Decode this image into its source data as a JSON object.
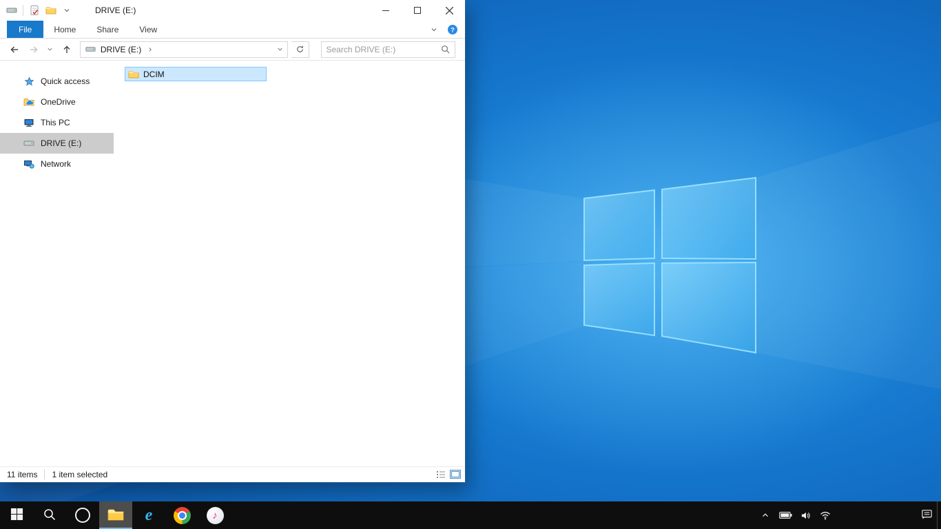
{
  "explorer": {
    "titlebar": {
      "title": "DRIVE (E:)"
    },
    "quick_access_toolbar": {
      "icons": [
        "drive-icon",
        "properties-icon",
        "new-folder-icon",
        "customize-chevron-icon"
      ]
    },
    "ribbon": {
      "tabs": [
        {
          "label": "File",
          "active": true
        },
        {
          "label": "Home",
          "active": false
        },
        {
          "label": "Share",
          "active": false
        },
        {
          "label": "View",
          "active": false
        }
      ],
      "right_icons": [
        "expand-ribbon-chevron-icon",
        "help-icon"
      ]
    },
    "navigation": {
      "back_enabled": true,
      "forward_enabled": false
    },
    "address": {
      "segment": "DRIVE (E:)"
    },
    "search": {
      "placeholder": "Search DRIVE (E:)"
    },
    "sidebar": {
      "items": [
        {
          "label": "Quick access",
          "icon": "quick-access-star-icon",
          "selected": false
        },
        {
          "label": "OneDrive",
          "icon": "onedrive-icon",
          "selected": false
        },
        {
          "label": "This PC",
          "icon": "this-pc-icon",
          "selected": false
        },
        {
          "label": "DRIVE (E:)",
          "icon": "drive-icon",
          "selected": true
        },
        {
          "label": "Network",
          "icon": "network-icon",
          "selected": false
        }
      ]
    },
    "files": {
      "items": [
        {
          "label": "DCIM",
          "icon": "folder-icon",
          "selected": true
        }
      ]
    },
    "statusbar": {
      "items_count": "11 items",
      "selection": "1 item selected",
      "view_icons": [
        "details-view-icon",
        "thumbnails-view-icon"
      ]
    }
  },
  "taskbar": {
    "buttons": [
      {
        "name": "start",
        "icon": "windows-logo-icon",
        "active": false
      },
      {
        "name": "search",
        "icon": "search-icon",
        "active": false
      },
      {
        "name": "cortana",
        "icon": "cortana-icon",
        "active": false
      },
      {
        "name": "file-explorer",
        "icon": "file-explorer-icon",
        "active": true
      },
      {
        "name": "internet-explorer",
        "icon": "internet-explorer-icon",
        "active": false
      },
      {
        "name": "chrome",
        "icon": "chrome-icon",
        "active": false
      },
      {
        "name": "itunes",
        "icon": "itunes-icon",
        "active": false
      }
    ],
    "tray": [
      {
        "name": "hidden-icons",
        "icon": "chevron-up-icon"
      },
      {
        "name": "battery",
        "icon": "battery-icon"
      },
      {
        "name": "volume",
        "icon": "speaker-icon"
      },
      {
        "name": "network",
        "icon": "wifi-icon"
      },
      {
        "name": "action-center",
        "icon": "action-center-icon"
      }
    ]
  },
  "colors": {
    "accent_blue": "#1979ca",
    "selection_bg": "#cce8ff",
    "selection_border": "#84c5ff",
    "sidebar_selected": "#cccccc",
    "taskbar_bg": "#0e0e0e",
    "wallpaper_base": "#1474cb"
  }
}
